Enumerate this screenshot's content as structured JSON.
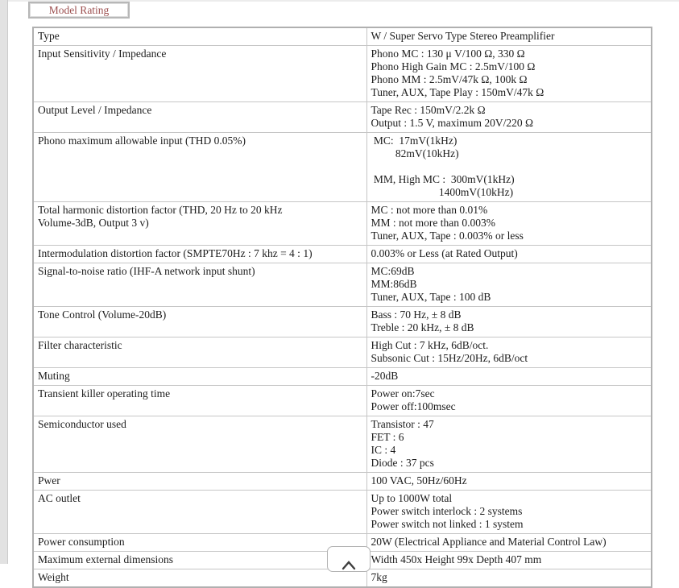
{
  "header": {
    "button_label": "Model Rating"
  },
  "colors": {
    "accent_text": "#9c4f4f",
    "table_border": "#b0b0b0",
    "cell_border": "#c6c6c6",
    "gutter": "#e2e2e2",
    "text": "#1c1c1c"
  },
  "icons": {
    "back_to_top": "chevron-up-icon"
  },
  "table": {
    "rows": [
      {
        "label": "Type",
        "value": "W / Super Servo Type Stereo Preamplifier"
      },
      {
        "label": "Input Sensitivity / Impedance",
        "value": "Phono MC : 130 μ V/100 Ω, 330 Ω\nPhono High Gain MC : 2.5mV/100 Ω\nPhono MM : 2.5mV/47k Ω, 100k Ω\nTuner, AUX, Tape Play : 150mV/47k Ω"
      },
      {
        "label": "Output Level / Impedance",
        "value": "Tape Rec : 150mV/2.2k Ω\nOutput : 1.5 V, maximum 20V/220 Ω"
      },
      {
        "label": "Phono maximum allowable input (THD 0.05%)",
        "value": " MC:  17mV(1kHz)\n         82mV(10kHz)\n\n MM, High MC :  300mV(1kHz)\n                         1400mV(10kHz)"
      },
      {
        "label": "Total harmonic distortion factor (THD, 20 Hz to 20 kHz\nVolume-3dB, Output 3 v)",
        "value": "MC : not more than 0.01%\nMM : not more than 0.003%\nTuner, AUX, Tape : 0.003% or less"
      },
      {
        "label": "Intermodulation distortion factor (SMPTE70Hz : 7 khz = 4 : 1)",
        "value": "0.003% or Less (at Rated Output)"
      },
      {
        "label": "Signal-to-noise ratio (IHF-A network input shunt)",
        "value": "MC:69dB\nMM:86dB\nTuner, AUX, Tape : 100 dB"
      },
      {
        "label": "Tone Control (Volume-20dB)",
        "value": "Bass : 70 Hz, ± 8 dB\nTreble : 20 kHz, ± 8 dB"
      },
      {
        "label": "Filter characteristic",
        "value": "High Cut : 7 kHz, 6dB/oct.\nSubsonic Cut : 15Hz/20Hz, 6dB/oct"
      },
      {
        "label": "Muting",
        "value": "-20dB"
      },
      {
        "label": "Transient killer operating time",
        "value": "Power on:7sec\nPower off:100msec"
      },
      {
        "label": "Semiconductor used",
        "value": "Transistor : 47\nFET : 6\nIC : 4\nDiode : 37 pcs"
      },
      {
        "label": "Pwer",
        "value": "100 VAC, 50Hz/60Hz"
      },
      {
        "label": "AC outlet",
        "value": "Up to 1000W total\nPower switch interlock : 2 systems\nPower switch not linked : 1 system"
      },
      {
        "label": "Power consumption",
        "value": "20W (Electrical Appliance and Material Control Law)"
      },
      {
        "label": "Maximum external dimensions",
        "value": "Width 450x Height 99x Depth 407 mm"
      },
      {
        "label": "Weight",
        "value": "7kg"
      }
    ]
  }
}
